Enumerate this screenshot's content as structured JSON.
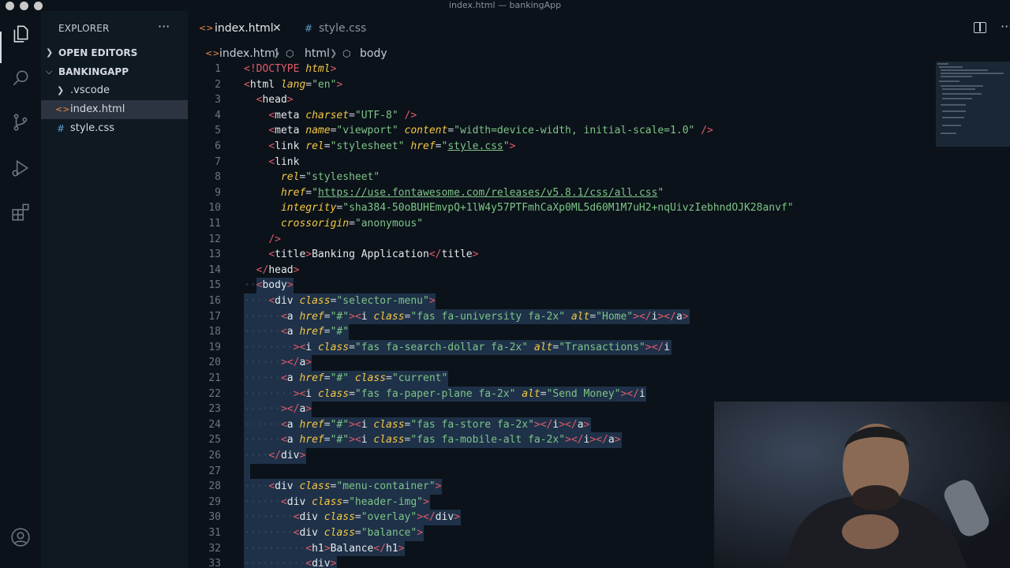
{
  "window": {
    "title": "index.html — bankingApp"
  },
  "activity_bar": {
    "icons": [
      "files-icon",
      "search-icon",
      "source-control-icon",
      "run-debug-icon",
      "extensions-icon",
      "account-icon"
    ]
  },
  "sidebar": {
    "header": "EXPLORER",
    "more": "···",
    "open_editors": "OPEN EDITORS",
    "project": "BANKINGAPP",
    "items": [
      {
        "label": ".vscode",
        "type": "folder"
      },
      {
        "label": "index.html",
        "type": "html-file",
        "selected": true
      },
      {
        "label": "style.css",
        "type": "css-file"
      }
    ]
  },
  "tabs": [
    {
      "label": "index.html",
      "icon": "<>",
      "active": true
    },
    {
      "label": "style.css",
      "icon": "#",
      "active": false
    }
  ],
  "breadcrumb": [
    "index.html",
    "html",
    "body"
  ],
  "colors": {
    "background": "#0b1219",
    "sidebar": "#0f1922",
    "tag": "#e05a6b",
    "attr": "#f5c842",
    "string": "#7ec488",
    "selection": "#1e3148"
  },
  "code_lines": [
    {
      "n": "1",
      "indent": 0,
      "sel": false,
      "tokens": [
        [
          "tag",
          "<!DOCTYPE "
        ],
        [
          "attr",
          "html"
        ],
        [
          "tag",
          ">"
        ]
      ]
    },
    {
      "n": "2",
      "indent": 0,
      "sel": false,
      "tokens": [
        [
          "tag",
          "<"
        ],
        [
          "name",
          "html "
        ],
        [
          "attr",
          "lang"
        ],
        [
          "eq",
          "="
        ],
        [
          "str",
          "\"en\""
        ],
        [
          "tag",
          ">"
        ]
      ]
    },
    {
      "n": "3",
      "indent": 1,
      "sel": false,
      "tokens": [
        [
          "tag",
          "<"
        ],
        [
          "name",
          "head"
        ],
        [
          "tag",
          ">"
        ]
      ]
    },
    {
      "n": "4",
      "indent": 2,
      "sel": false,
      "tokens": [
        [
          "tag",
          "<"
        ],
        [
          "name",
          "meta "
        ],
        [
          "attr",
          "charset"
        ],
        [
          "eq",
          "="
        ],
        [
          "str",
          "\"UTF-8\""
        ],
        [
          "tag",
          " />"
        ]
      ]
    },
    {
      "n": "5",
      "indent": 2,
      "sel": false,
      "tokens": [
        [
          "tag",
          "<"
        ],
        [
          "name",
          "meta "
        ],
        [
          "attr",
          "name"
        ],
        [
          "eq",
          "="
        ],
        [
          "str",
          "\"viewport\" "
        ],
        [
          "attr",
          "content"
        ],
        [
          "eq",
          "="
        ],
        [
          "str",
          "\"width=device-width, initial-scale=1.0\""
        ],
        [
          "tag",
          " />"
        ]
      ]
    },
    {
      "n": "6",
      "indent": 2,
      "sel": false,
      "tokens": [
        [
          "tag",
          "<"
        ],
        [
          "name",
          "link "
        ],
        [
          "attr",
          "rel"
        ],
        [
          "eq",
          "="
        ],
        [
          "str",
          "\"stylesheet\" "
        ],
        [
          "attr",
          "href"
        ],
        [
          "eq",
          "="
        ],
        [
          "str",
          "\""
        ],
        [
          "link",
          "style.css"
        ],
        [
          "str",
          "\""
        ],
        [
          "tag",
          ">"
        ]
      ]
    },
    {
      "n": "7",
      "indent": 2,
      "sel": false,
      "tokens": [
        [
          "tag",
          "<"
        ],
        [
          "name",
          "link"
        ]
      ]
    },
    {
      "n": "8",
      "indent": 3,
      "sel": false,
      "tokens": [
        [
          "attr",
          "rel"
        ],
        [
          "eq",
          "="
        ],
        [
          "str",
          "\"stylesheet\""
        ]
      ]
    },
    {
      "n": "9",
      "indent": 3,
      "sel": false,
      "tokens": [
        [
          "attr",
          "href"
        ],
        [
          "eq",
          "="
        ],
        [
          "str",
          "\""
        ],
        [
          "link",
          "https://use.fontawesome.com/releases/v5.8.1/css/all.css"
        ],
        [
          "str",
          "\""
        ]
      ]
    },
    {
      "n": "10",
      "indent": 3,
      "sel": false,
      "tokens": [
        [
          "attr",
          "integrity"
        ],
        [
          "eq",
          "="
        ],
        [
          "str",
          "\"sha384-50oBUHEmvpQ+1lW4y57PTFmhCaXp0ML5d60M1M7uH2+nqUivzIebhndOJK28anvf\""
        ]
      ]
    },
    {
      "n": "11",
      "indent": 3,
      "sel": false,
      "tokens": [
        [
          "attr",
          "crossorigin"
        ],
        [
          "eq",
          "="
        ],
        [
          "str",
          "\"anonymous\""
        ]
      ]
    },
    {
      "n": "12",
      "indent": 2,
      "sel": false,
      "tokens": [
        [
          "tag",
          "/>"
        ]
      ]
    },
    {
      "n": "13",
      "indent": 2,
      "sel": false,
      "tokens": [
        [
          "tag",
          "<"
        ],
        [
          "name",
          "title"
        ],
        [
          "tag",
          ">"
        ],
        [
          "text",
          "Banking Application"
        ],
        [
          "tag",
          "</"
        ],
        [
          "name",
          "title"
        ],
        [
          "tag",
          ">"
        ]
      ]
    },
    {
      "n": "14",
      "indent": 1,
      "sel": false,
      "tokens": [
        [
          "tag",
          "</"
        ],
        [
          "name",
          "head"
        ],
        [
          "tag",
          ">"
        ]
      ]
    },
    {
      "n": "15",
      "indent": 1,
      "sel": true,
      "tokens": [
        [
          "tag",
          "<"
        ],
        [
          "name",
          "body"
        ],
        [
          "tag",
          ">"
        ]
      ]
    },
    {
      "n": "16",
      "indent": 2,
      "sel": true,
      "tokens": [
        [
          "tag",
          "<"
        ],
        [
          "name",
          "div "
        ],
        [
          "attr",
          "class"
        ],
        [
          "eq",
          "="
        ],
        [
          "str",
          "\"selector-menu\""
        ],
        [
          "tag",
          ">"
        ]
      ]
    },
    {
      "n": "17",
      "indent": 3,
      "sel": true,
      "tokens": [
        [
          "tag",
          "<"
        ],
        [
          "name",
          "a "
        ],
        [
          "attr",
          "href"
        ],
        [
          "eq",
          "="
        ],
        [
          "str",
          "\"#\""
        ],
        [
          "tag",
          "><"
        ],
        [
          "name",
          "i "
        ],
        [
          "attr",
          "class"
        ],
        [
          "eq",
          "="
        ],
        [
          "str",
          "\"fas fa-university fa-2x\" "
        ],
        [
          "attr",
          "alt"
        ],
        [
          "eq",
          "="
        ],
        [
          "str",
          "\"Home\""
        ],
        [
          "tag",
          "></"
        ],
        [
          "name",
          "i"
        ],
        [
          "tag",
          "></"
        ],
        [
          "name",
          "a"
        ],
        [
          "tag",
          ">"
        ]
      ]
    },
    {
      "n": "18",
      "indent": 3,
      "sel": true,
      "tokens": [
        [
          "tag",
          "<"
        ],
        [
          "name",
          "a "
        ],
        [
          "attr",
          "href"
        ],
        [
          "eq",
          "="
        ],
        [
          "str",
          "\"#\""
        ]
      ]
    },
    {
      "n": "19",
      "indent": 4,
      "sel": true,
      "tokens": [
        [
          "tag",
          "><"
        ],
        [
          "name",
          "i "
        ],
        [
          "attr",
          "class"
        ],
        [
          "eq",
          "="
        ],
        [
          "str",
          "\"fas fa-search-dollar fa-2x\" "
        ],
        [
          "attr",
          "alt"
        ],
        [
          "eq",
          "="
        ],
        [
          "str",
          "\"Transactions\""
        ],
        [
          "tag",
          "></"
        ],
        [
          "name",
          "i"
        ]
      ]
    },
    {
      "n": "20",
      "indent": 3,
      "sel": true,
      "tokens": [
        [
          "tag",
          "></"
        ],
        [
          "name",
          "a"
        ],
        [
          "tag",
          ">"
        ]
      ]
    },
    {
      "n": "21",
      "indent": 3,
      "sel": true,
      "tokens": [
        [
          "tag",
          "<"
        ],
        [
          "name",
          "a "
        ],
        [
          "attr",
          "href"
        ],
        [
          "eq",
          "="
        ],
        [
          "str",
          "\"#\" "
        ],
        [
          "attr",
          "class"
        ],
        [
          "eq",
          "="
        ],
        [
          "str",
          "\"current\""
        ]
      ]
    },
    {
      "n": "22",
      "indent": 4,
      "sel": true,
      "tokens": [
        [
          "tag",
          "><"
        ],
        [
          "name",
          "i "
        ],
        [
          "attr",
          "class"
        ],
        [
          "eq",
          "="
        ],
        [
          "str",
          "\"fas fa-paper-plane fa-2x\" "
        ],
        [
          "attr",
          "alt"
        ],
        [
          "eq",
          "="
        ],
        [
          "str",
          "\"Send Money\""
        ],
        [
          "tag",
          "></"
        ],
        [
          "name",
          "i"
        ]
      ]
    },
    {
      "n": "23",
      "indent": 3,
      "sel": true,
      "tokens": [
        [
          "tag",
          "></"
        ],
        [
          "name",
          "a"
        ],
        [
          "tag",
          ">"
        ]
      ]
    },
    {
      "n": "24",
      "indent": 3,
      "sel": true,
      "tokens": [
        [
          "tag",
          "<"
        ],
        [
          "name",
          "a "
        ],
        [
          "attr",
          "href"
        ],
        [
          "eq",
          "="
        ],
        [
          "str",
          "\"#\""
        ],
        [
          "tag",
          "><"
        ],
        [
          "name",
          "i "
        ],
        [
          "attr",
          "class"
        ],
        [
          "eq",
          "="
        ],
        [
          "str",
          "\"fas fa-store fa-2x\""
        ],
        [
          "tag",
          "></"
        ],
        [
          "name",
          "i"
        ],
        [
          "tag",
          "></"
        ],
        [
          "name",
          "a"
        ],
        [
          "tag",
          ">"
        ]
      ]
    },
    {
      "n": "25",
      "indent": 3,
      "sel": true,
      "tokens": [
        [
          "tag",
          "<"
        ],
        [
          "name",
          "a "
        ],
        [
          "attr",
          "href"
        ],
        [
          "eq",
          "="
        ],
        [
          "str",
          "\"#\""
        ],
        [
          "tag",
          "><"
        ],
        [
          "name",
          "i "
        ],
        [
          "attr",
          "class"
        ],
        [
          "eq",
          "="
        ],
        [
          "str",
          "\"fas fa-mobile-alt fa-2x\""
        ],
        [
          "tag",
          "></"
        ],
        [
          "name",
          "i"
        ],
        [
          "tag",
          "></"
        ],
        [
          "name",
          "a"
        ],
        [
          "tag",
          ">"
        ]
      ]
    },
    {
      "n": "26",
      "indent": 2,
      "sel": true,
      "tokens": [
        [
          "tag",
          "</"
        ],
        [
          "name",
          "div"
        ],
        [
          "tag",
          ">"
        ]
      ]
    },
    {
      "n": "27",
      "indent": 0,
      "sel": true,
      "tokens": []
    },
    {
      "n": "28",
      "indent": 2,
      "sel": true,
      "tokens": [
        [
          "tag",
          "<"
        ],
        [
          "name",
          "div "
        ],
        [
          "attr",
          "class"
        ],
        [
          "eq",
          "="
        ],
        [
          "str",
          "\"menu-container\""
        ],
        [
          "tag",
          ">"
        ]
      ]
    },
    {
      "n": "29",
      "indent": 3,
      "sel": true,
      "tokens": [
        [
          "tag",
          "<"
        ],
        [
          "name",
          "div "
        ],
        [
          "attr",
          "class"
        ],
        [
          "eq",
          "="
        ],
        [
          "str",
          "\"header-img\""
        ],
        [
          "tag",
          ">"
        ]
      ]
    },
    {
      "n": "30",
      "indent": 4,
      "sel": true,
      "tokens": [
        [
          "tag",
          "<"
        ],
        [
          "name",
          "div "
        ],
        [
          "attr",
          "class"
        ],
        [
          "eq",
          "="
        ],
        [
          "str",
          "\"overlay\""
        ],
        [
          "tag",
          "></"
        ],
        [
          "name",
          "div"
        ],
        [
          "tag",
          ">"
        ]
      ]
    },
    {
      "n": "31",
      "indent": 4,
      "sel": true,
      "tokens": [
        [
          "tag",
          "<"
        ],
        [
          "name",
          "div "
        ],
        [
          "attr",
          "class"
        ],
        [
          "eq",
          "="
        ],
        [
          "str",
          "\"balance\""
        ],
        [
          "tag",
          ">"
        ]
      ]
    },
    {
      "n": "32",
      "indent": 5,
      "sel": true,
      "tokens": [
        [
          "tag",
          "<"
        ],
        [
          "name",
          "h1"
        ],
        [
          "tag",
          ">"
        ],
        [
          "text",
          "Balance"
        ],
        [
          "tag",
          "</"
        ],
        [
          "name",
          "h1"
        ],
        [
          "tag",
          ">"
        ]
      ]
    },
    {
      "n": "33",
      "indent": 5,
      "sel": true,
      "tokens": [
        [
          "tag",
          "<"
        ],
        [
          "name",
          "div"
        ],
        [
          "tag",
          ">"
        ]
      ]
    }
  ]
}
